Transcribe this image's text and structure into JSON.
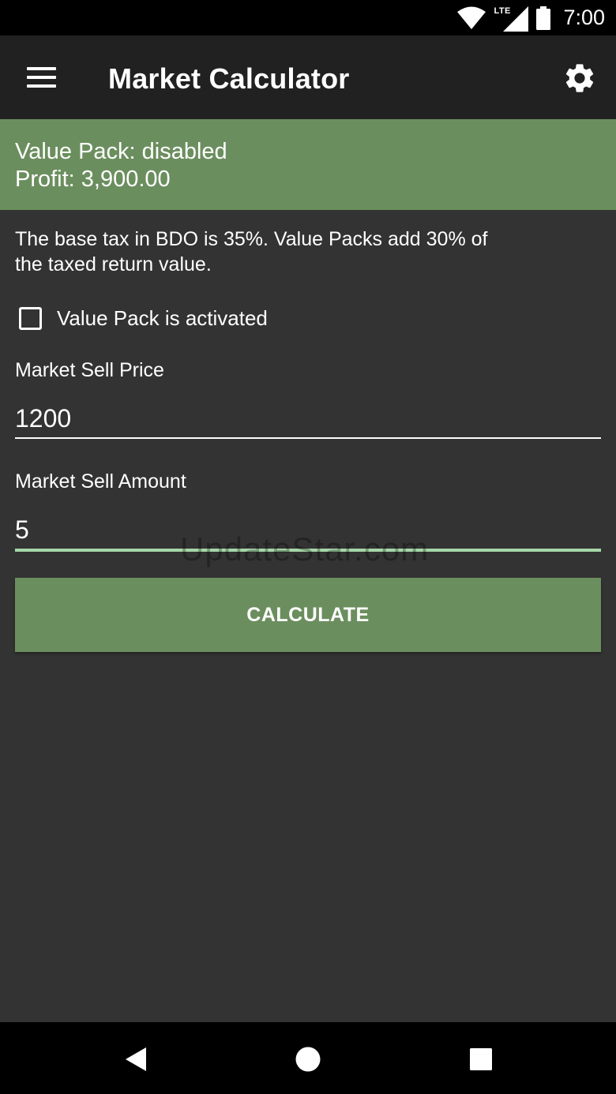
{
  "status_bar": {
    "network_label": "LTE",
    "time": "7:00"
  },
  "app_bar": {
    "title": "Market Calculator",
    "menu_icon": "menu-icon",
    "settings_icon": "gear-icon"
  },
  "result": {
    "value_pack_status": "Value Pack: disabled",
    "profit": "Profit: 3,900.00"
  },
  "info": {
    "description": "The base tax in BDO is 35%. Value Packs add 30% of the taxed return value."
  },
  "value_pack_checkbox": {
    "label": "Value Pack is activated",
    "checked": false
  },
  "sell_price": {
    "label": "Market Sell Price",
    "value": "1200"
  },
  "sell_amount": {
    "label": "Market Sell Amount",
    "value": "5"
  },
  "calculate_button": {
    "label": "CALCULATE"
  },
  "watermark": "UpdateStar.com",
  "colors": {
    "background": "#333333",
    "app_bar": "#212121",
    "accent_green": "#6b8e5e",
    "focused_underline": "#a5d6a7",
    "status_bar": "#000000"
  }
}
